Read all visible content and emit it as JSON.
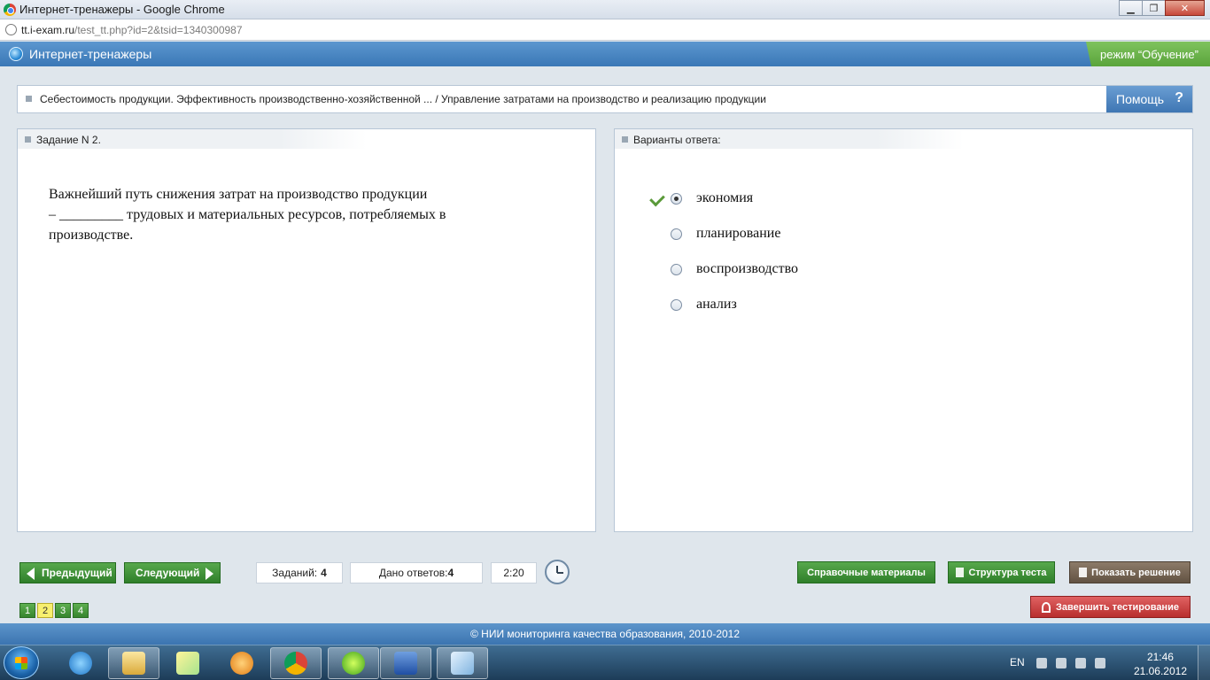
{
  "window": {
    "title": "Интернет-тренажеры - Google Chrome",
    "minimize": "▁",
    "maximize": "❐",
    "close": "✕"
  },
  "address": {
    "host": "tt.i-exam.ru",
    "path": "/test_tt.php?id=2&tsid=1340300987"
  },
  "app": {
    "title": "Интернет-тренажеры",
    "mode": "режим “Обучение”"
  },
  "breadcrumb": {
    "text": "Себестоимость продукции. Эффективность производственно-хозяйственной ... / Управление затратами на производство и реализацию продукции",
    "help_label": "Помощь",
    "help_icon": "?"
  },
  "task": {
    "header": "Задание N 2.",
    "question_line1": "Важнейший путь снижения затрат на производство продукции",
    "question_line2": "– _________ трудовых и материальных ресурсов, потребляемых в",
    "question_line3": "производстве."
  },
  "answers": {
    "header": "Варианты ответа:",
    "options": [
      {
        "label": "экономия",
        "selected": true,
        "correct": true
      },
      {
        "label": "планирование",
        "selected": false,
        "correct": false
      },
      {
        "label": "воспроизводство",
        "selected": false,
        "correct": false
      },
      {
        "label": "анализ",
        "selected": false,
        "correct": false
      }
    ]
  },
  "toolbar": {
    "prev_label": "Предыдущий",
    "next_label": "Следующий",
    "tasks_label": "Заданий:",
    "tasks_value": "4",
    "answered_label": "Дано ответов:",
    "answered_value": "4",
    "timer": "2:20",
    "reference_label": "Справочные материалы",
    "structure_label": "Структура теста",
    "solution_label": "Показать решение",
    "finish_label": "Завершить тестирование",
    "pages": [
      "1",
      "2",
      "3",
      "4"
    ],
    "current_page": "2"
  },
  "footer": {
    "text": "© НИИ мониторинга качества образования, 2010-2012"
  },
  "taskbar": {
    "lang": "EN",
    "time": "21:46",
    "date": "21.06.2012"
  },
  "colors": {
    "header_blue": "#4a86c2",
    "mode_green": "#6bb44b",
    "button_green": "#3f8f36",
    "finish_red": "#c83a3a",
    "solution_brown": "#75654f"
  }
}
